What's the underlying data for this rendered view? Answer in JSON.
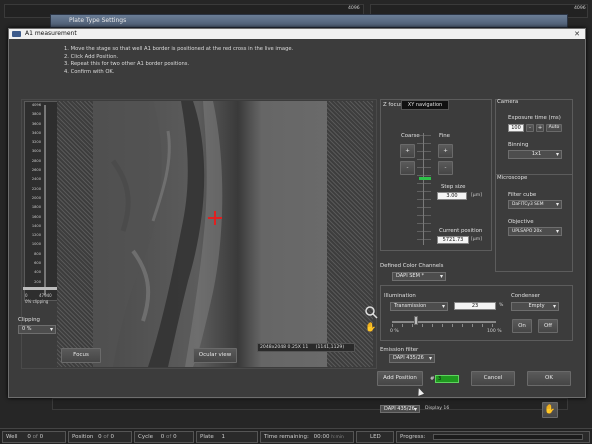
{
  "background": {
    "window_title": "Plate Type Settings",
    "numbers": [
      "4096",
      "4096"
    ],
    "bottom_field": "DAPI 435/26",
    "bottom_display": "Display 16"
  },
  "dialog": {
    "title": "A1 measurement",
    "close": "✕",
    "instructions": [
      "1. Move the stage so that well A1 border is positioned at the red cross in the live image.",
      "2. Click Add Position.",
      "3. Repeat this for two other A1 border positions.",
      "4. Confirm with OK."
    ]
  },
  "histogram": {
    "scale": [
      "4096",
      "3800",
      "3600",
      "3400",
      "3200",
      "3000",
      "2800",
      "2600",
      "2400",
      "2200",
      "2000",
      "1800",
      "1600",
      "1400",
      "1200",
      "1000",
      "800",
      "600",
      "400",
      "200"
    ],
    "min": "0",
    "max": "47940",
    "clipping_caption": "0% clipping",
    "clipping_label": "Clipping",
    "clipping_value": "0 %"
  },
  "image": {
    "info": "2048x2048 0.25X 11",
    "coords": "(1141,1129)"
  },
  "buttons": {
    "focus": "Focus",
    "ocular": "Ocular view",
    "add_position": "Add Position",
    "cancel": "Cancel",
    "ok": "OK"
  },
  "zfocus": {
    "tab_z": "Z focus",
    "tab_xy": "XY navigation",
    "coarse": "Coarse",
    "fine": "Fine",
    "step_size_label": "Step size",
    "step_size": "3.00",
    "unit": "[µm]",
    "current_position_label": "Current position",
    "current_position": "5721.73",
    "plus": "+",
    "minus": "-"
  },
  "camera": {
    "title": "Camera",
    "exposure_label": "Exposure time (ms)",
    "exposure": "100",
    "minus": "-",
    "plus": "+",
    "auto": "Auto",
    "binning_label": "Binning",
    "binning": "1x1"
  },
  "microscope": {
    "title": "Microscope",
    "filter_label": "Filter cube",
    "filter": "DaFITCy3 SEM",
    "objective_label": "Objective",
    "objective": "UPLSAPO 20x"
  },
  "channels": {
    "label": "Defined Color Channels",
    "value": "DAPI SEM *"
  },
  "illumination": {
    "label": "Illumination",
    "value": "Transmission",
    "intensity": "23",
    "percent": "%",
    "scale_min": "0 %",
    "scale_max": "100 %",
    "level": 0.23
  },
  "condenser": {
    "label": "Condenser",
    "value": "Empty",
    "on": "On",
    "off": "Off"
  },
  "emission": {
    "label": "Emission filter",
    "value": "DAPI 435/26"
  },
  "position_count": {
    "hash": "#",
    "value": "3"
  },
  "statusbar": {
    "well_label": "Well",
    "well_a": "0",
    "of": "of",
    "well_b": "0",
    "position_label": "Position",
    "position_a": "0",
    "position_b": "0",
    "cycle_label": "Cycle",
    "cycle_a": "0",
    "cycle_b": "0",
    "plate_label": "Plate",
    "plate": "1",
    "time_label": "Time remaining:",
    "time": "00:00",
    "time_unit": "h:min",
    "led": "LED",
    "progress": "Progress:"
  },
  "colors": {
    "cross": "#e02020",
    "count_bg": "#1f9a1f",
    "titlebar": "#f0f0f0"
  }
}
